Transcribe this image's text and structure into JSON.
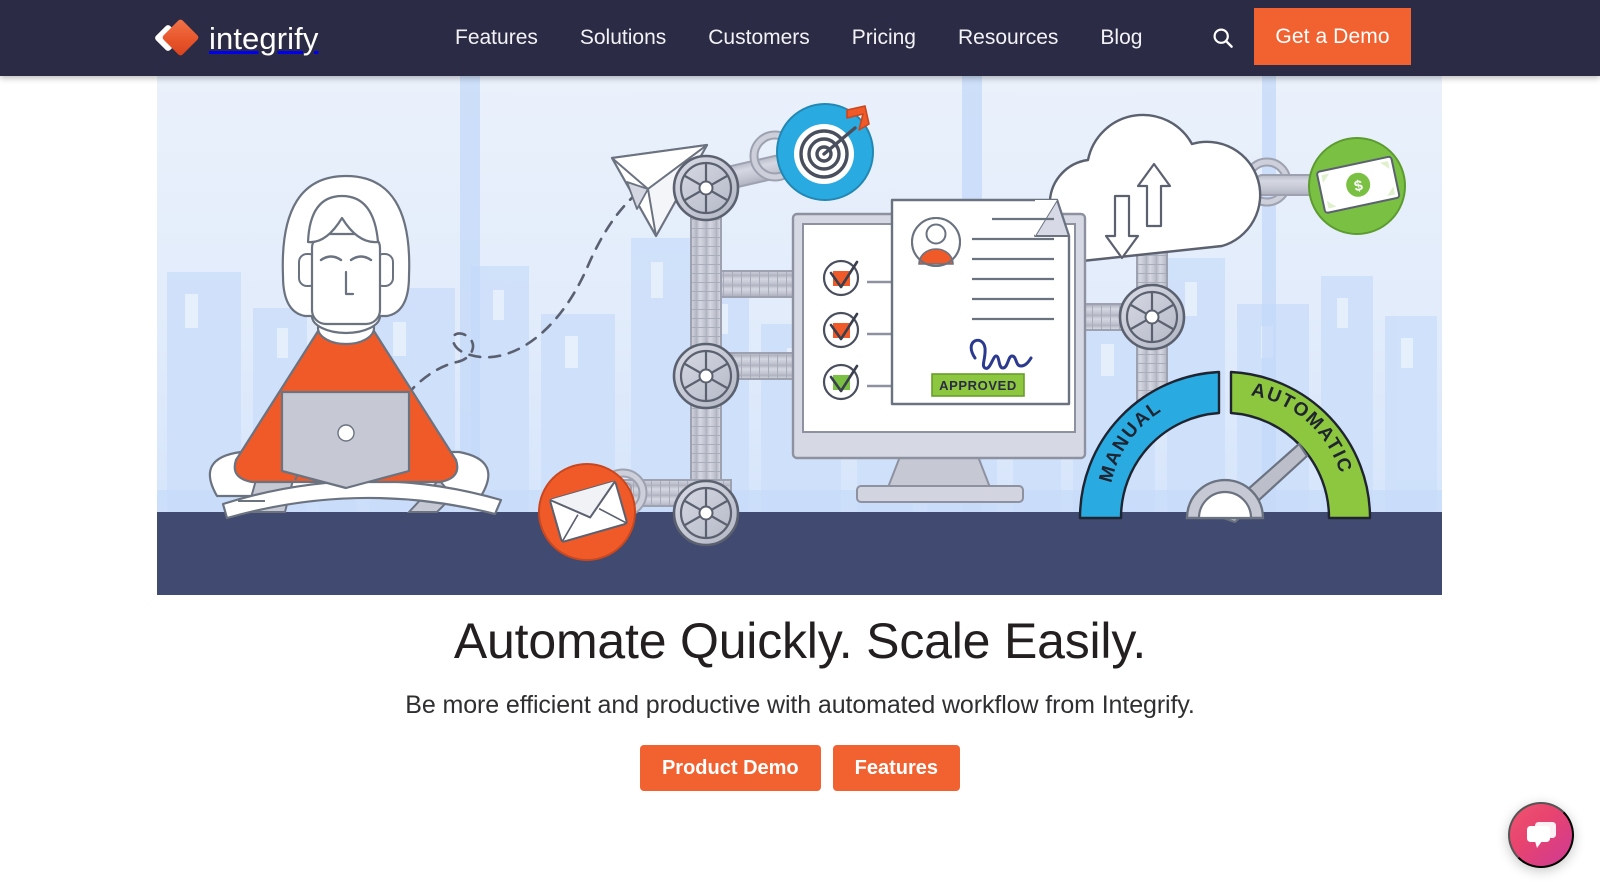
{
  "header": {
    "logo": {
      "text": "integrify",
      "icon": "integrify-diamond-logo",
      "colors": {
        "orange": "#e8542a",
        "white": "#ffffff"
      }
    },
    "nav_items": [
      {
        "label": "Features"
      },
      {
        "label": "Solutions"
      },
      {
        "label": "Customers"
      },
      {
        "label": "Pricing"
      },
      {
        "label": "Resources"
      },
      {
        "label": "Blog"
      }
    ],
    "search_icon": "search-icon",
    "cta_label": "Get a Demo",
    "background_color": "#2b2b45",
    "cta_color": "#f26231"
  },
  "hero": {
    "title": "Automate Quickly. Scale Easily.",
    "subtitle": "Be more efficient and productive with automated workflow from Integrify.",
    "buttons": [
      {
        "label": "Product Demo"
      },
      {
        "label": "Features"
      }
    ],
    "illustration": {
      "alt": "workflow-automation-illustration",
      "document_status_label": "APPROVED",
      "gauge_left_label": "MANUAL",
      "gauge_right_label": "AUTOMATIC",
      "icon_badges": [
        {
          "name": "target-badge",
          "color": "#29abe2"
        },
        {
          "name": "money-badge",
          "color": "#7ac143"
        },
        {
          "name": "email-badge",
          "color": "#f05a28"
        }
      ],
      "colors": {
        "sky": "#dde9fb",
        "floor": "#414a70",
        "approved_green": "#7ac143",
        "gauge_blue": "#29abe2",
        "gauge_green": "#7ac143",
        "accent_orange": "#f05a28"
      }
    }
  },
  "chat": {
    "icon": "chat-bubble-icon",
    "color": "#e8446f"
  }
}
